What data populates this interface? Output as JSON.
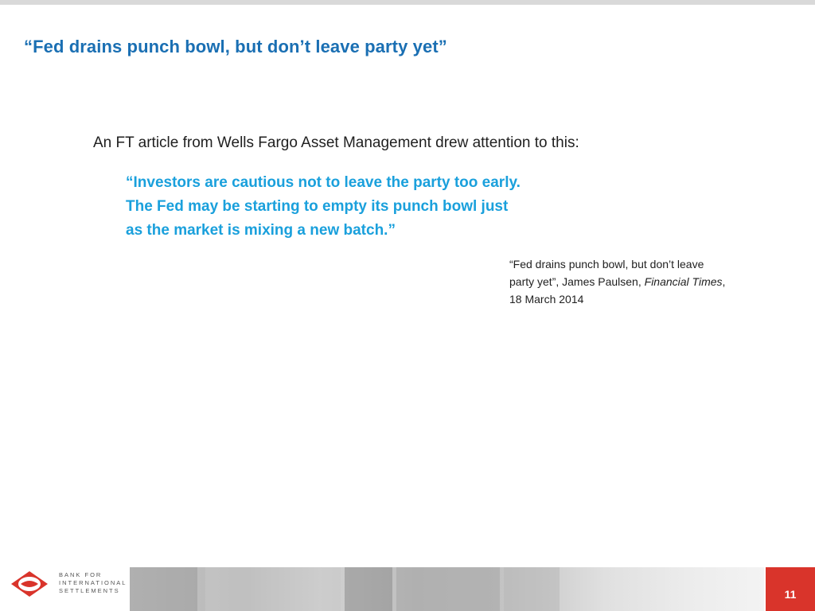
{
  "slide": {
    "title": "“Fed drains punch bowl, but don’t leave party yet”",
    "intro": "An FT article from Wells Fargo Asset Management drew attention to this:",
    "quote_lines": [
      "“Investors are cautious not to leave the party too early.",
      "The Fed may be starting to empty its punch bowl just",
      "as the market is mixing a new batch.”"
    ],
    "citation": {
      "line1": "“Fed drains punch bowl, but don’t leave",
      "line2_prefix": "party yet”, James Paulsen, ",
      "line2_italic": "Financial Times",
      "line2_suffix": ",",
      "line3": "18 March 2014"
    },
    "page_number": "11"
  },
  "footer": {
    "logo_lines": [
      "BANK FOR",
      "INTERNATIONAL",
      "SETTLEMENTS"
    ]
  },
  "colors": {
    "title": "#1a6fb3",
    "quote": "#1aa0dc",
    "page_box": "#d9342b"
  }
}
